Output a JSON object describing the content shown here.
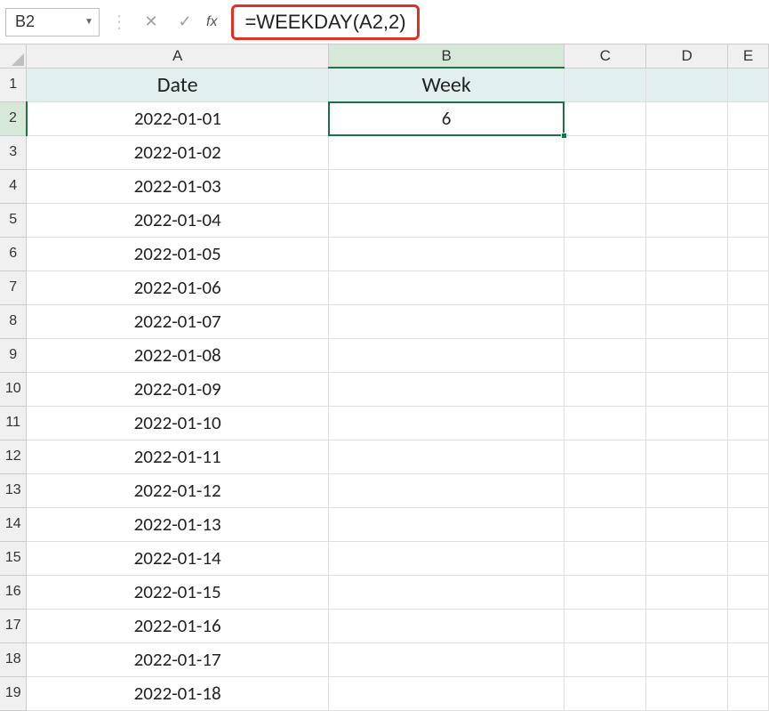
{
  "nameBox": {
    "value": "B2"
  },
  "formulaBar": {
    "formula": "=WEEKDAY(A2,2)"
  },
  "columns": [
    {
      "letter": "A",
      "width": "col-A",
      "selected": false
    },
    {
      "letter": "B",
      "width": "col-B",
      "selected": true
    },
    {
      "letter": "C",
      "width": "col-C",
      "selected": false
    },
    {
      "letter": "D",
      "width": "col-D",
      "selected": false
    },
    {
      "letter": "E",
      "width": "col-E",
      "selected": false
    }
  ],
  "headerRow": {
    "num": 1,
    "A": "Date",
    "B": "Week"
  },
  "activeCell": {
    "row": 2,
    "col": "B"
  },
  "rows": [
    {
      "num": 2,
      "A": "2022-01-01",
      "B": "6"
    },
    {
      "num": 3,
      "A": "2022-01-02",
      "B": ""
    },
    {
      "num": 4,
      "A": "2022-01-03",
      "B": ""
    },
    {
      "num": 5,
      "A": "2022-01-04",
      "B": ""
    },
    {
      "num": 6,
      "A": "2022-01-05",
      "B": ""
    },
    {
      "num": 7,
      "A": "2022-01-06",
      "B": ""
    },
    {
      "num": 8,
      "A": "2022-01-07",
      "B": ""
    },
    {
      "num": 9,
      "A": "2022-01-08",
      "B": ""
    },
    {
      "num": 10,
      "A": "2022-01-09",
      "B": ""
    },
    {
      "num": 11,
      "A": "2022-01-10",
      "B": ""
    },
    {
      "num": 12,
      "A": "2022-01-11",
      "B": ""
    },
    {
      "num": 13,
      "A": "2022-01-12",
      "B": ""
    },
    {
      "num": 14,
      "A": "2022-01-13",
      "B": ""
    },
    {
      "num": 15,
      "A": "2022-01-14",
      "B": ""
    },
    {
      "num": 16,
      "A": "2022-01-15",
      "B": ""
    },
    {
      "num": 17,
      "A": "2022-01-16",
      "B": ""
    },
    {
      "num": 18,
      "A": "2022-01-17",
      "B": ""
    },
    {
      "num": 19,
      "A": "2022-01-18",
      "B": ""
    }
  ]
}
